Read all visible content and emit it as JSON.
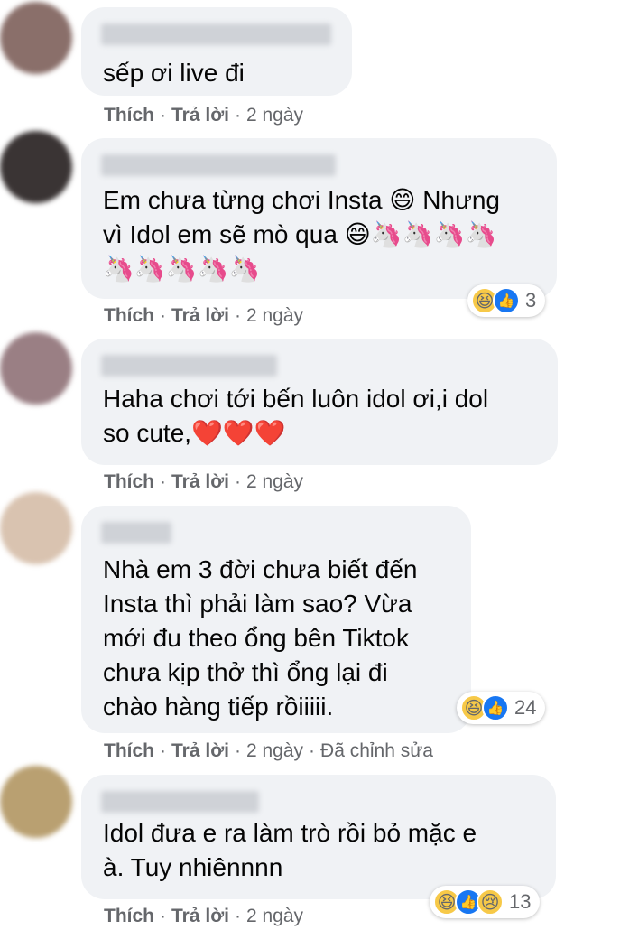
{
  "actions": {
    "like": "Thích",
    "reply": "Trả lời",
    "separator": "·"
  },
  "comments": [
    {
      "text_lines": [
        "sếp ơi live đi"
      ],
      "time": "2 ngày",
      "avatar_color": "#8a6f6a"
    },
    {
      "text_lines": [
        "Em chưa từng chơi Insta 😄 Nhưng",
        "vì Idol em sẽ mò qua 😄🦄🦄🦄🦄",
        "🦄🦄🦄🦄🦄"
      ],
      "time": "2 ngày",
      "reaction_count": "3",
      "reaction_icons": [
        "haha-icon",
        "like-icon"
      ],
      "avatar_color": "#3a3434"
    },
    {
      "text_lines": [
        "Haha chơi tới bến luôn idol ơi,i dol",
        "so cute,❤️❤️❤️"
      ],
      "time": "2 ngày",
      "avatar_color": "#9a7f84"
    },
    {
      "text_lines": [
        "Nhà em 3 đời chưa biết đến",
        "Insta thì phải làm sao? Vừa",
        "mới đu theo ổng bên Tiktok",
        "chưa kịp thở thì ổng lại đi",
        "chào hàng tiếp rồiiiii."
      ],
      "time": "2 ngày",
      "edited": "Đã chỉnh sửa",
      "reaction_count": "24",
      "reaction_icons": [
        "haha-icon",
        "like-icon"
      ],
      "avatar_color": "#d9c3b0"
    },
    {
      "text_lines": [
        "Idol đưa e ra làm trò rồi bỏ mặc e",
        "à. Tuy nhiênnnn"
      ],
      "time": "2 ngày",
      "reaction_count": "13",
      "reaction_icons": [
        "haha-icon",
        "like-icon",
        "sad-icon"
      ],
      "avatar_color": "#b9a071"
    }
  ]
}
